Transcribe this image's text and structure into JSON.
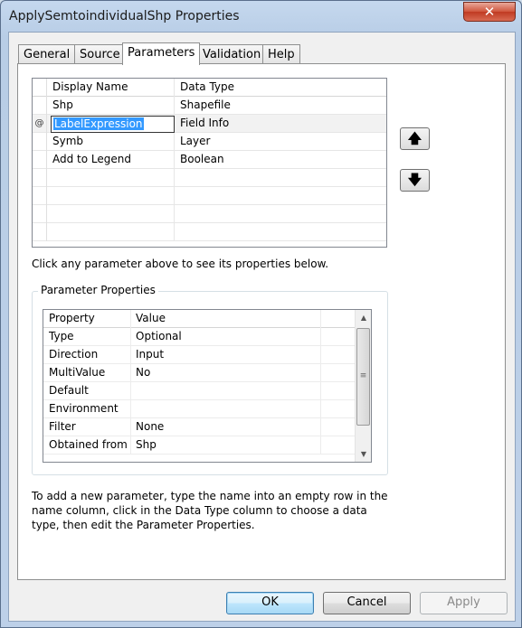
{
  "window": {
    "title": "ApplySemtoindividualShp Properties",
    "close_glyph": "✕"
  },
  "tabs": [
    {
      "label": "General"
    },
    {
      "label": "Source"
    },
    {
      "label": "Parameters"
    },
    {
      "label": "Validation"
    },
    {
      "label": "Help"
    }
  ],
  "parameters": {
    "columns": [
      "Display Name",
      "Data Type"
    ],
    "rows": [
      {
        "marker": "",
        "name": "Shp",
        "type": "Shapefile"
      },
      {
        "marker": "@",
        "name": "LabelExpression",
        "type": "Field Info"
      },
      {
        "marker": "",
        "name": "Symb",
        "type": "Layer"
      },
      {
        "marker": "",
        "name": "Add to Legend",
        "type": "Boolean"
      }
    ],
    "move_up_icon": "arrow-up-icon",
    "move_down_icon": "arrow-down-icon",
    "move_up_glyph": "🡅",
    "move_down_glyph": "🡇"
  },
  "hint": "Click any parameter above to see its properties below.",
  "properties": {
    "group_label": "Parameter Properties",
    "columns": [
      "Property",
      "Value"
    ],
    "rows": [
      {
        "property": "Type",
        "value": "Optional"
      },
      {
        "property": "Direction",
        "value": "Input"
      },
      {
        "property": "MultiValue",
        "value": "No"
      },
      {
        "property": "Default",
        "value": ""
      },
      {
        "property": "Environment",
        "value": ""
      },
      {
        "property": "Filter",
        "value": "None"
      },
      {
        "property": "Obtained from",
        "value": "Shp"
      }
    ]
  },
  "instructions": "To add a new parameter, type the name into an empty row in the name column, click in the Data Type column to choose a data type, then edit the Parameter Properties.",
  "buttons": {
    "ok": "OK",
    "cancel": "Cancel",
    "apply": "Apply"
  }
}
